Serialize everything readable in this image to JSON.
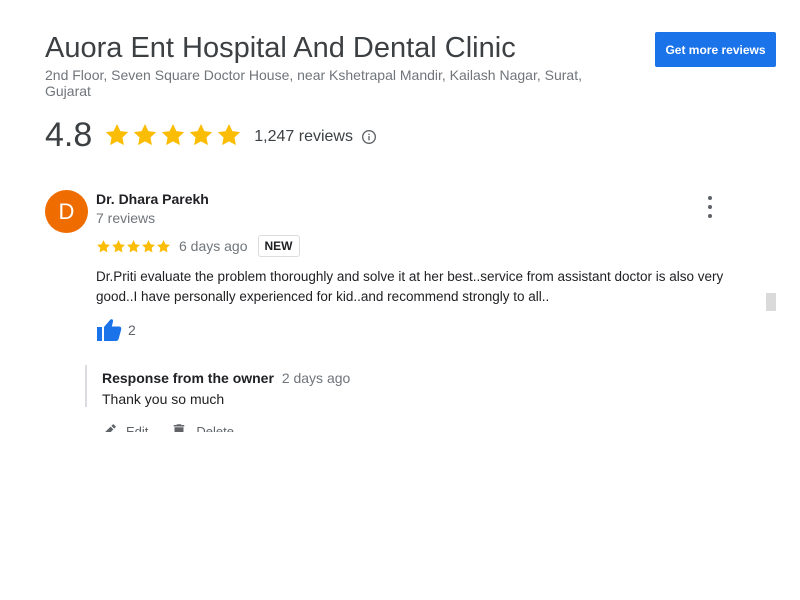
{
  "business": {
    "name": "Auora Ent Hospital And Dental Clinic",
    "address": "2nd Floor, Seven Square Doctor House, near Kshetrapal Mandir, Kailash Nagar, Surat, Gujarat",
    "get_more_reviews_label": "Get more reviews"
  },
  "summary": {
    "rating": "4.8",
    "stars": 5,
    "reviews_count": "1,247 reviews",
    "info_icon": "info-icon"
  },
  "review": {
    "avatar_initial": "D",
    "reviewer_name": "Dr. Dhara Parekh",
    "reviewer_review_count": "7 reviews",
    "stars": 5,
    "time_ago": "6 days ago",
    "badge": "NEW",
    "text": "Dr.Priti evaluate the problem thoroughly and solve it at her best..service from assistant doctor is also very good..I have personally experienced for kid..and recommend strongly to all..",
    "like_count": "2",
    "menu_icon": "more-vert-icon"
  },
  "owner_response": {
    "label": "Response from the owner",
    "time_ago": "2 days ago",
    "text": "Thank you so much",
    "edit_label": "Edit",
    "delete_label": "Delete"
  },
  "colors": {
    "star": "#fbbc04",
    "accent": "#1a73e8",
    "avatar": "#ef6c00",
    "secondary_text": "#70757a"
  }
}
